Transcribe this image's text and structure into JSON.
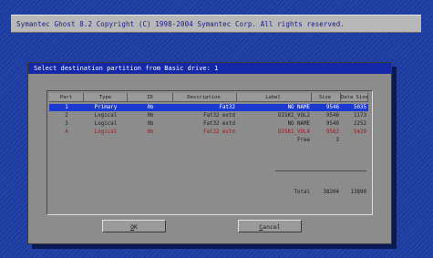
{
  "window": {
    "title": "Symantec Ghost 8.2   Copyright (C) 1998-2004 Symantec Corp. All rights reserved."
  },
  "dialog": {
    "title": "Select destination partition from Basic drive: 1"
  },
  "table": {
    "headers": [
      "Part",
      "Type",
      "ID",
      "Description",
      "Label",
      "Size",
      "Data Size"
    ],
    "rows": [
      {
        "part": "1",
        "type": "Primary",
        "id": "0b",
        "description": "Fat32",
        "label": "NO NAME",
        "size": "9546",
        "data_size": "5035",
        "state": "selected"
      },
      {
        "part": "2",
        "type": "Logical",
        "id": "0b",
        "description": "Fat32 extd",
        "label": "DISK1_VOL2",
        "size": "9546",
        "data_size": "1173",
        "state": "normal"
      },
      {
        "part": "3",
        "type": "Logical",
        "id": "0b",
        "description": "Fat32 extd",
        "label": "NO NAME",
        "size": "9546",
        "data_size": "2252",
        "state": "normal"
      },
      {
        "part": "4",
        "type": "Logical",
        "id": "0b",
        "description": "Fat32 extd",
        "label": "DISK1_VOL4",
        "size": "9562",
        "data_size": "5429",
        "state": "source"
      },
      {
        "part": "",
        "type": "",
        "id": "",
        "description": "",
        "label": "Free",
        "size": "3",
        "data_size": "",
        "state": "normal"
      }
    ],
    "total": {
      "label": "Total",
      "size": "38204",
      "data_size": "13890"
    }
  },
  "buttons": {
    "ok": "OK",
    "cancel": "Cancel"
  },
  "colors": {
    "desktop": "#1d3fa6",
    "title_bar_bg": "#1428a8",
    "selected_row": "#1c3ad0",
    "source_row_text": "#a01818"
  }
}
